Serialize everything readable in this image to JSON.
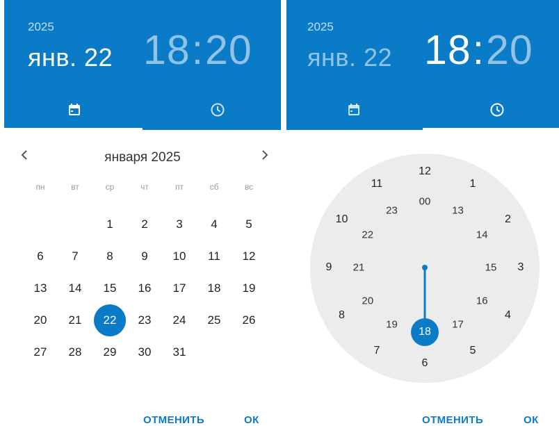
{
  "left": {
    "header": {
      "year": "2025",
      "date": "янв. 22",
      "hours": "18",
      "colon": ":",
      "minutes": "20"
    },
    "calendar": {
      "month_title": "января 2025",
      "weekdays": [
        "пн",
        "вт",
        "ср",
        "чт",
        "пт",
        "сб",
        "вс"
      ],
      "leading_blanks": 2,
      "days": [
        "1",
        "2",
        "3",
        "4",
        "5",
        "6",
        "7",
        "8",
        "9",
        "10",
        "11",
        "12",
        "13",
        "14",
        "15",
        "16",
        "17",
        "18",
        "19",
        "20",
        "21",
        "22",
        "23",
        "24",
        "25",
        "26",
        "27",
        "28",
        "29",
        "30",
        "31"
      ],
      "selected_day": "22"
    },
    "actions": {
      "cancel": "ОТМЕНИТЬ",
      "ok": "ОК"
    }
  },
  "right": {
    "header": {
      "year": "2025",
      "date": "янв. 22",
      "hours": "18",
      "colon": ":",
      "minutes": "20"
    },
    "clock": {
      "outer": [
        "12",
        "1",
        "2",
        "3",
        "4",
        "5",
        "6",
        "7",
        "8",
        "9",
        "10",
        "11"
      ],
      "inner": [
        "00",
        "13",
        "14",
        "15",
        "16",
        "17",
        "18",
        "19",
        "20",
        "21",
        "22",
        "23"
      ],
      "selected": "18"
    },
    "actions": {
      "cancel": "ОТМЕНИТЬ",
      "ok": "ОК"
    }
  },
  "colors": {
    "primary": "#0a7bc7",
    "dial": "#ececec"
  },
  "icons": {
    "prev": "chevron-left-icon",
    "next": "chevron-right-icon",
    "calendar": "calendar-icon",
    "clock": "clock-icon"
  }
}
